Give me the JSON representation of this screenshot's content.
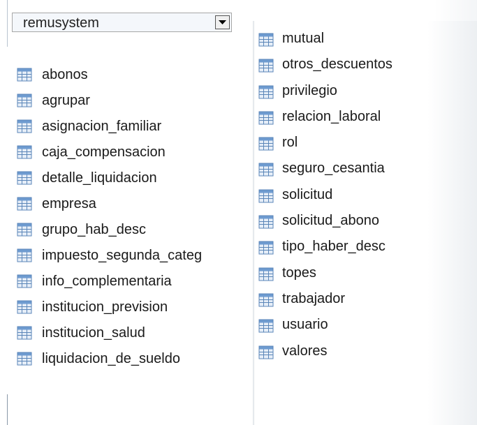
{
  "database_select": {
    "value": "remusystem"
  },
  "tables_left": [
    "abonos",
    "agrupar",
    "asignacion_familiar",
    "caja_compensacion",
    "detalle_liquidacion",
    "empresa",
    "grupo_hab_desc",
    "impuesto_segunda_categ",
    "info_complementaria",
    "institucion_prevision",
    "institucion_salud",
    "liquidacion_de_sueldo"
  ],
  "tables_right": [
    "mutual",
    "otros_descuentos",
    "privilegio",
    "relacion_laboral",
    "rol",
    "seguro_cesantia",
    "solicitud",
    "solicitud_abono",
    "tipo_haber_desc",
    "topes",
    "trabajador",
    "usuario",
    "valores"
  ],
  "icons": {
    "table_icon": "table-icon",
    "dropdown_icon": "chevron-down-icon"
  },
  "colors": {
    "icon_border": "#5b86b8",
    "icon_header": "#6e9bd0",
    "icon_cell": "#e6eef8"
  }
}
